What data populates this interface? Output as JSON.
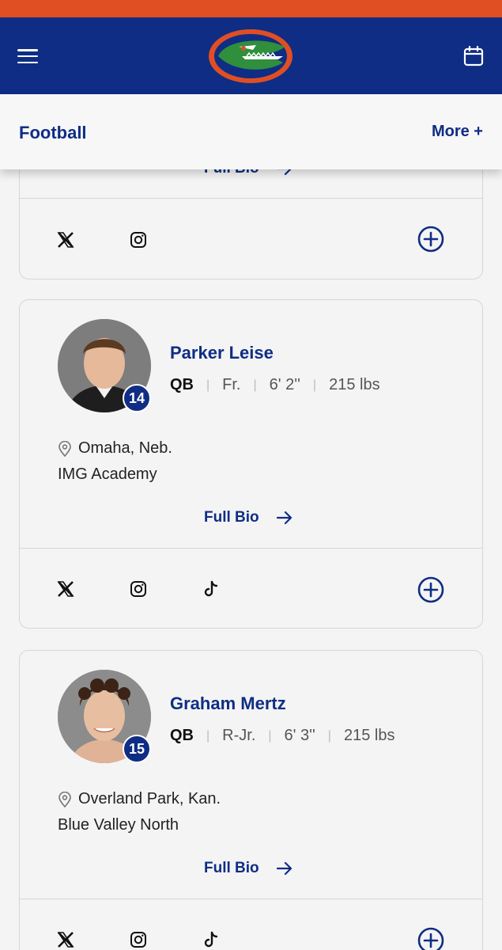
{
  "header": {
    "sport_title": "Football",
    "more_label": "More +"
  },
  "colors": {
    "navy": "#0f2d84",
    "orange": "#e04e23"
  },
  "previous_card": {
    "full_bio_label": "Full Bio",
    "social": [
      "x-icon",
      "instagram-icon"
    ]
  },
  "players": [
    {
      "name": "Parker Leise",
      "number": "14",
      "position": "QB",
      "class_year": "Fr.",
      "height": "6' 2''",
      "weight": "215 lbs",
      "hometown": "Omaha, Neb.",
      "school": "IMG Academy",
      "full_bio_label": "Full Bio",
      "social": [
        "x-icon",
        "instagram-icon",
        "tiktok-icon"
      ]
    },
    {
      "name": "Graham Mertz",
      "number": "15",
      "position": "QB",
      "class_year": "R-Jr.",
      "height": "6' 3''",
      "weight": "215 lbs",
      "hometown": "Overland Park, Kan.",
      "school": "Blue Valley North",
      "full_bio_label": "Full Bio",
      "social": [
        "x-icon",
        "instagram-icon",
        "tiktok-icon"
      ]
    }
  ]
}
